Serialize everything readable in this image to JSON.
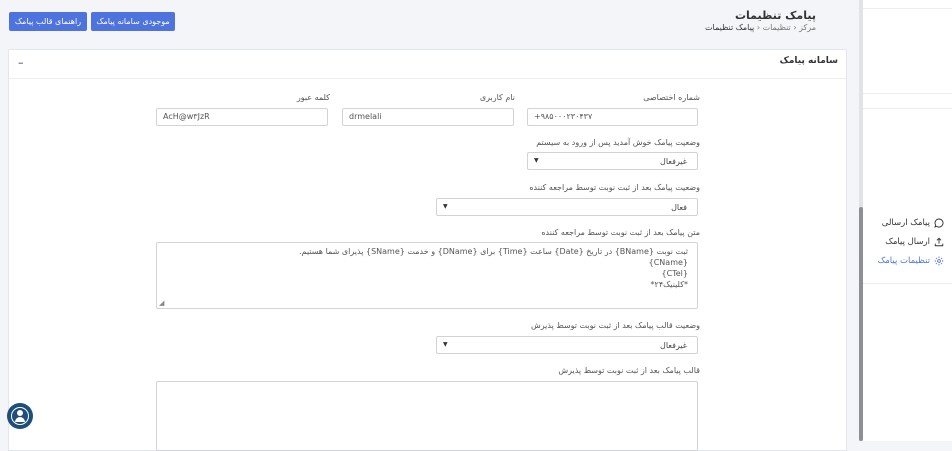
{
  "header": {
    "title": "پیامک تنظیمات",
    "breadcrumb": [
      "مرکز",
      "تنظیمات",
      "پیامک تنظیمات"
    ],
    "breadcrumb_sep": "‹",
    "buttons": {
      "guide": "راهنمای قالب پیامک",
      "inventory": "موجودی سامانه پیامک"
    }
  },
  "card": {
    "title": "سامانه پیامک",
    "collapse_symbol": "–",
    "fields": {
      "phone": {
        "label": "شماره اختصاصی",
        "value": "+۹۸۵۰۰۰۲۳۰۴۳۷"
      },
      "username": {
        "label": "نام کاربری",
        "value": "drmelali"
      },
      "password": {
        "label": "کلمه عبور",
        "value": "AcH@w۳JzR"
      },
      "welcome_status": {
        "label": "وضعیت پیامک خوش آمدید پس از ورود به سیستم",
        "value": "غیرفعال"
      },
      "after_booking_status": {
        "label": "وضعیت پیامک بعد از ثبت نوبت توسط مراجعه کننده",
        "value": "فعال"
      },
      "after_booking_text": {
        "label": "متن پیامک بعد از ثبت نوبت توسط مراجعه کننده",
        "lines": [
          "ثبت نوبت {BName} در تاریخ {Date} ساعت {Time} برای {DName} و خدمت {SName} پذیرای شما هستیم.",
          "{CName}",
          "{CTel}",
          "*کلینیک۲۴*"
        ]
      },
      "reception_template_status": {
        "label": "وضعیت قالب پیامک بعد از ثبت نوبت توسط پذیرش",
        "value": "غیرفعال"
      },
      "reception_template": {
        "label": "قالب پیامک بعد از ثبت نوبت توسط پذیرش"
      }
    }
  },
  "sidebar": {
    "items": [
      {
        "label": "پیامک ارسالی",
        "icon": "message-icon",
        "active": false
      },
      {
        "label": "ارسال پیامک",
        "icon": "upload-icon",
        "active": false
      },
      {
        "label": "تنظیمات پیامک",
        "icon": "gear-icon",
        "active": true
      }
    ]
  },
  "colors": {
    "accent": "#4e73df",
    "fab": "#1e4e7a"
  }
}
